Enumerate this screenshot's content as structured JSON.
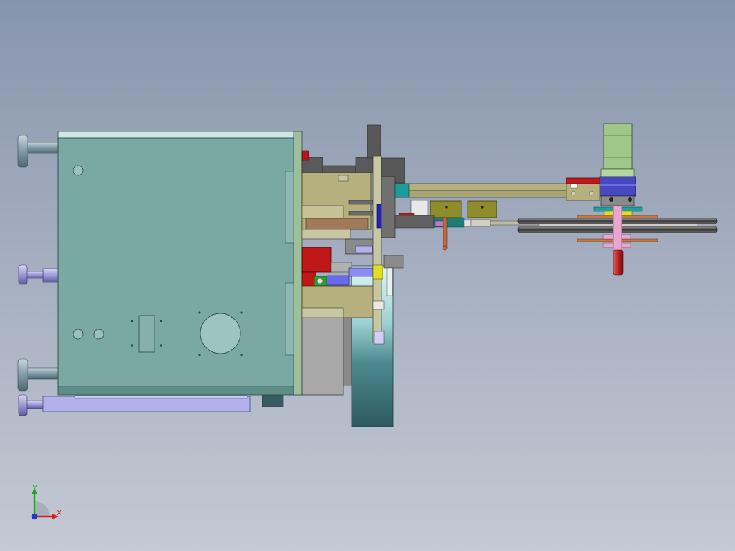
{
  "triad": {
    "x_label": "X",
    "y_label": "Y",
    "x_color": "#d42020",
    "y_color": "#1fa81f",
    "z_color": "#1f3bd4"
  },
  "colors": {
    "background_top": "#8795ab",
    "background_bottom": "#c4c9d3",
    "cabinet": "#7aa8a2",
    "cabinet_frame": "#9fbf9a",
    "base_plate": "#b3b0ea",
    "khaki": "#b5b07e",
    "olive": "#8f8c2a",
    "red": "#c01818",
    "blue": "#3030c8",
    "teal": "#1f7a7a",
    "dark_gray": "#505050",
    "steel": "#7e8a96",
    "green_motor": "#9fc78a",
    "pink": "#e8a6d0",
    "copper": "#b86a3a"
  }
}
